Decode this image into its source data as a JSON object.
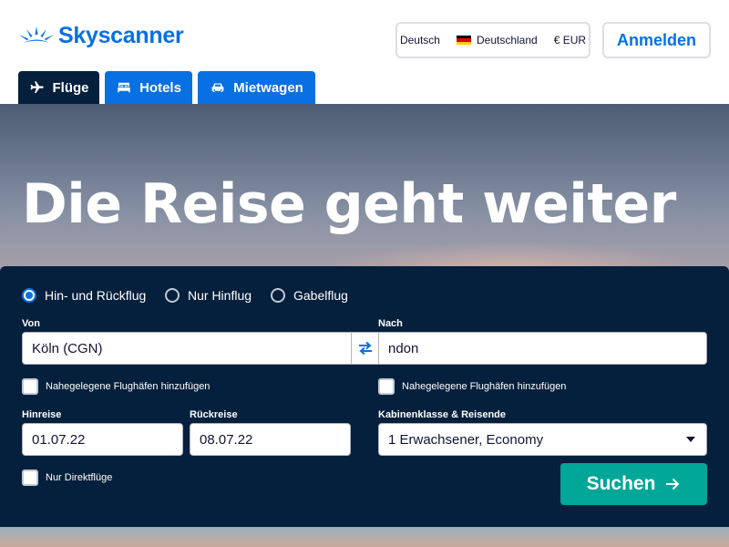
{
  "brand": {
    "name": "Skyscanner",
    "color": "#0770e3"
  },
  "header": {
    "language": "Deutsch",
    "country": "Deutschland",
    "currency": "€ EUR",
    "login_label": "Anmelden"
  },
  "tabs": [
    {
      "label": "Flüge",
      "icon": "plane-icon",
      "active": true
    },
    {
      "label": "Hotels",
      "icon": "bed-icon",
      "active": false
    },
    {
      "label": "Mietwagen",
      "icon": "car-icon",
      "active": false
    }
  ],
  "hero": {
    "title": "Die Reise geht weiter"
  },
  "search": {
    "trip_types": [
      {
        "label": "Hin- und Rückflug",
        "selected": true
      },
      {
        "label": "Nur Hinflug",
        "selected": false
      },
      {
        "label": "Gabelflug",
        "selected": false
      }
    ],
    "from_label": "Von",
    "from_value": "Köln (CGN)",
    "to_label": "Nach",
    "to_value": "ndon",
    "nearby_from": "Nahegelegene Flughäfen hinzufügen",
    "nearby_to": "Nahegelegene Flughäfen hinzufügen",
    "depart_label": "Hinreise",
    "depart_value": "01.07.22",
    "return_label": "Rückreise",
    "return_value": "08.07.22",
    "cabin_label": "Kabinenklasse & Reisende",
    "cabin_value": "1 Erwachsener, Economy",
    "direct_only": "Nur Direktflüge",
    "search_label": "Suchen",
    "search_color": "#00a698",
    "panel_color": "#05203c"
  }
}
